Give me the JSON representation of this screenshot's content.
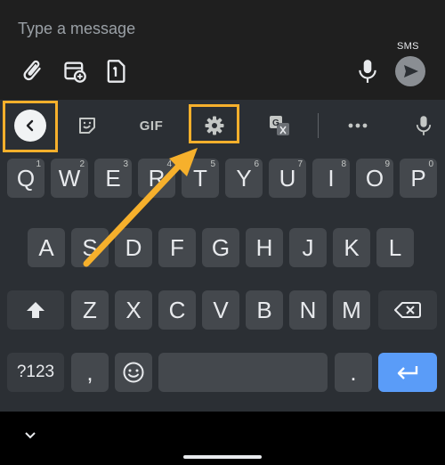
{
  "compose": {
    "placeholder": "Type a message",
    "sms_label": "SMS",
    "icons": [
      "attach-icon",
      "schedule-icon",
      "sim-1-icon",
      "mic-icon",
      "send-icon"
    ]
  },
  "toolbar": {
    "items": [
      "back-chevron-icon",
      "sticker-icon",
      "gif",
      "settings-gear-icon",
      "translate-icon",
      "more-dots-icon",
      "mic-icon"
    ],
    "gif_label": "GIF"
  },
  "keyboard": {
    "row1": [
      {
        "label": "Q",
        "hint": "1"
      },
      {
        "label": "W",
        "hint": "2"
      },
      {
        "label": "E",
        "hint": "3"
      },
      {
        "label": "R",
        "hint": "4"
      },
      {
        "label": "T",
        "hint": "5"
      },
      {
        "label": "Y",
        "hint": "6"
      },
      {
        "label": "U",
        "hint": "7"
      },
      {
        "label": "I",
        "hint": "8"
      },
      {
        "label": "O",
        "hint": "9"
      },
      {
        "label": "P",
        "hint": "0"
      }
    ],
    "row2": [
      "A",
      "S",
      "D",
      "F",
      "G",
      "H",
      "J",
      "K",
      "L"
    ],
    "row3": [
      "Z",
      "X",
      "C",
      "V",
      "B",
      "N",
      "M"
    ],
    "symbols_label": "?123",
    "comma": ",",
    "period": "."
  },
  "colors": {
    "highlight": "#f6b02c",
    "enter_key": "#5a9cf8",
    "key": "#44484d",
    "keyboard_bg": "#2b2f34"
  }
}
